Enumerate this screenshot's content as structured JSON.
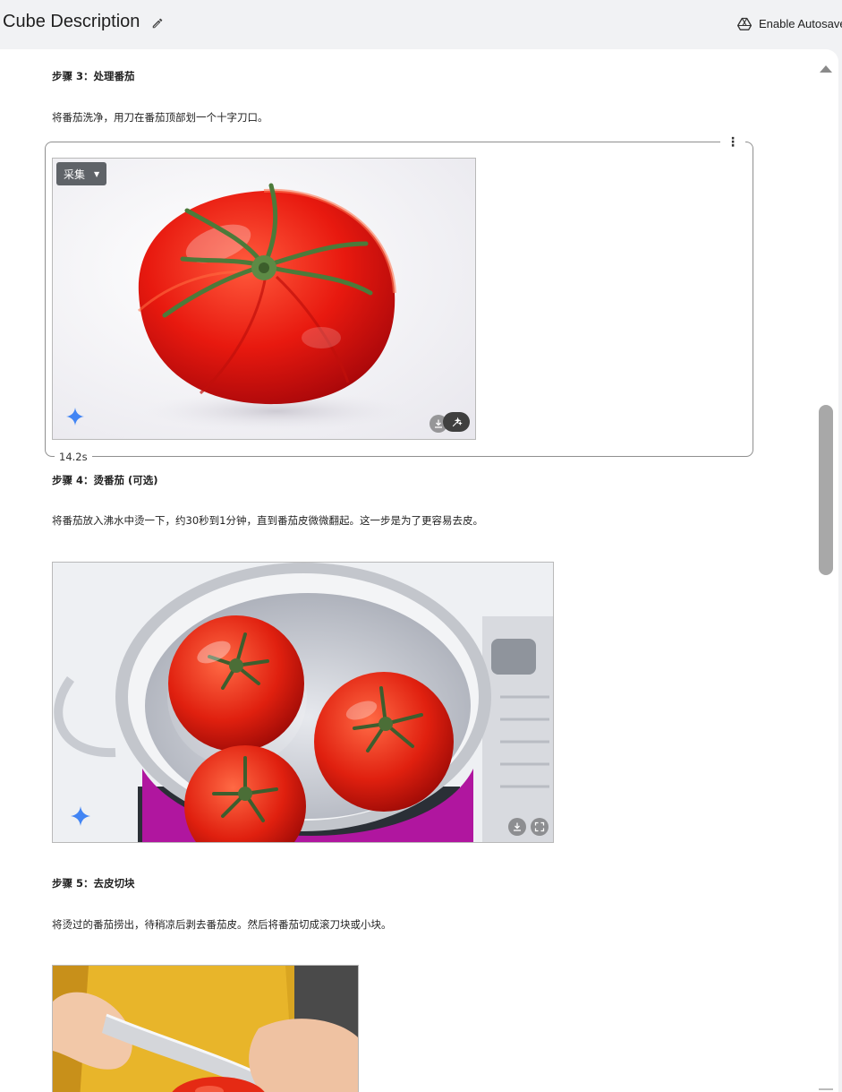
{
  "header": {
    "title": "Cube Description",
    "autosave_label": "Enable Autosave"
  },
  "steps": [
    {
      "heading": "步骤 3：处理番茄",
      "text": "将番茄洗净，用刀在番茄顶部划一个十字刀口。"
    },
    {
      "heading": "步骤 4：烫番茄 (可选)",
      "text": "将番茄放入沸水中烫一下，约30秒到1分钟，直到番茄皮微微翻起。这一步是为了更容易去皮。"
    },
    {
      "heading": "步骤 5：去皮切块",
      "text": "将烫过的番茄捞出，待稍凉后剥去番茄皮。然后将番茄切成滚刀块或小块。"
    }
  ],
  "generation_card": {
    "menu_glyph": "⋮",
    "pick_label": "采集",
    "elapsed": "14.2s"
  },
  "icons": {
    "edit": "pencil-icon",
    "autosave": "drive-icon",
    "sparkle": "sparkle-icon",
    "download": "download-icon",
    "fullscreen": "fullscreen-icon",
    "magic_edit": "magic-wand-icon"
  },
  "colors": {
    "sparkle": "#4285f4",
    "scroll_thumb": "#a8a8a8"
  }
}
